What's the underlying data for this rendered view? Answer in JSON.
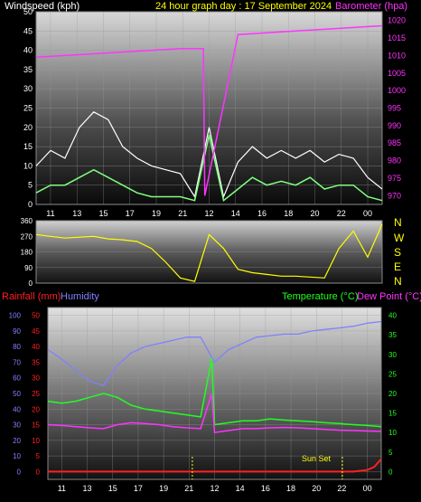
{
  "top": {
    "left_label": "Windspeed (kph)",
    "center_label": "24 hour graph day : 17 September 2024",
    "right_label": "Barometer (hpa)"
  },
  "mid": {
    "compass": [
      "N",
      "W",
      "S",
      "E",
      "N"
    ]
  },
  "bottom": {
    "rain_label": "Rainfall (mm)",
    "humidity_label": "Humidity",
    "temp_label": "Temperature (°C)",
    "dew_label": "Dew Point (°C)",
    "annotation": "Sun Set"
  },
  "colors": {
    "wind": "#ffffff",
    "gust": "#ffffff",
    "avg_wind": "#7fff7f",
    "barometer": "#ff33ff",
    "direction": "#ffff00",
    "rainfall": "#ff2020",
    "humidity": "#8080ff",
    "temperature": "#20ff20",
    "dewpoint": "#ff33ff"
  },
  "chart_data": [
    {
      "type": "line",
      "panel": "wind-barometer",
      "x_ticks": [
        "11",
        "13",
        "15",
        "17",
        "19",
        "21",
        "12",
        "14",
        "16",
        "18",
        "20",
        "22",
        "00"
      ],
      "y_left_ticks": [
        "0",
        "5",
        "10",
        "15",
        "20",
        "25",
        "30",
        "35",
        "40",
        "45",
        "50"
      ],
      "y_left_range": [
        0,
        50
      ],
      "y_right_ticks": [
        "970",
        "975",
        "980",
        "985",
        "990",
        "995",
        "1000",
        "1005",
        "1010",
        "1015",
        "1020"
      ],
      "y_right_range": [
        967.5,
        1022.5
      ],
      "series": [
        {
          "role": "gust",
          "x": [
            0,
            1,
            2,
            3,
            4,
            5,
            6,
            7,
            8,
            9,
            10,
            11,
            12,
            13,
            14,
            15,
            16,
            17,
            18,
            19,
            20,
            21,
            22,
            23,
            24
          ],
          "y": [
            10,
            14,
            12,
            20,
            24,
            22,
            15,
            12,
            10,
            9,
            8,
            2,
            20,
            2,
            11,
            15,
            12,
            14,
            12,
            14,
            11,
            13,
            12,
            7,
            4
          ]
        },
        {
          "role": "avg",
          "x": [
            0,
            1,
            2,
            3,
            4,
            5,
            6,
            7,
            8,
            9,
            10,
            11,
            12,
            13,
            14,
            15,
            16,
            17,
            18,
            19,
            20,
            21,
            22,
            23,
            24
          ],
          "y": [
            3,
            5,
            5,
            7,
            9,
            7,
            5,
            3,
            2,
            2,
            2,
            1,
            18,
            1,
            4,
            7,
            5,
            6,
            5,
            7,
            4,
            5,
            5,
            2,
            1
          ]
        },
        {
          "role": "barometer",
          "x": [
            0,
            2,
            4,
            6,
            8,
            10,
            11.6,
            11.7,
            14,
            16,
            18,
            20,
            22,
            24
          ],
          "y": [
            1009.5,
            1010,
            1010.5,
            1011,
            1011.5,
            1012,
            1012,
            970,
            1016,
            1016.5,
            1017,
            1017.5,
            1018,
            1018.5
          ]
        }
      ]
    },
    {
      "type": "line",
      "panel": "wind-direction",
      "y_ticks": [
        "0",
        "90",
        "180",
        "270",
        "360"
      ],
      "y_range": [
        0,
        360
      ],
      "series": [
        {
          "role": "direction",
          "x": [
            0,
            1,
            2,
            3,
            4,
            5,
            6,
            7,
            8,
            9,
            10,
            11,
            12,
            13,
            14,
            15,
            16,
            17,
            18,
            19,
            20,
            21,
            22,
            23,
            24
          ],
          "y": [
            280,
            270,
            260,
            265,
            270,
            255,
            250,
            240,
            200,
            120,
            30,
            10,
            280,
            200,
            80,
            60,
            50,
            40,
            40,
            35,
            30,
            200,
            300,
            150,
            340
          ]
        }
      ]
    },
    {
      "type": "line",
      "panel": "temperature-humidity",
      "x_ticks": [
        "11",
        "13",
        "15",
        "17",
        "19",
        "21",
        "12",
        "14",
        "16",
        "18",
        "20",
        "22",
        "00"
      ],
      "y_left_ticks": [
        "0",
        "5",
        "10",
        "15",
        "20",
        "25",
        "30",
        "35",
        "40",
        "45",
        "50"
      ],
      "y_left_range": [
        -2.5,
        52.5
      ],
      "y_rain_ticks": [
        "0",
        "10",
        "20",
        "30",
        "40",
        "50",
        "60",
        "70",
        "80",
        "90",
        "100"
      ],
      "y_rain_range": [
        -5,
        105
      ],
      "y_right_ticks": [
        "0",
        "5",
        "10",
        "15",
        "20",
        "25",
        "30",
        "35",
        "40"
      ],
      "y_right_range": [
        -2,
        42
      ],
      "series": [
        {
          "role": "humidity",
          "x": [
            0,
            1,
            2,
            3,
            4,
            5,
            6,
            7,
            8,
            9,
            10,
            11,
            12,
            13,
            14,
            15,
            16,
            17,
            18,
            19,
            20,
            21,
            22,
            23,
            24
          ],
          "y": [
            78,
            72,
            65,
            58,
            55,
            68,
            76,
            80,
            82,
            84,
            86,
            86,
            70,
            78,
            82,
            86,
            87,
            88,
            88,
            90,
            91,
            92,
            93,
            95,
            96
          ]
        },
        {
          "role": "temperature",
          "x": [
            0,
            1,
            2,
            3,
            4,
            5,
            6,
            7,
            8,
            9,
            10,
            11,
            11.8,
            12,
            13,
            14,
            15,
            16,
            17,
            18,
            19,
            20,
            21,
            22,
            23,
            24
          ],
          "y": [
            18,
            17.5,
            18,
            19,
            20,
            19,
            17,
            16,
            15.5,
            15,
            14.5,
            14,
            29,
            12,
            12.5,
            13,
            13,
            13.5,
            13.2,
            13,
            12.8,
            12.5,
            12.3,
            12,
            11.8,
            11.5
          ]
        },
        {
          "role": "dewpoint",
          "x": [
            0,
            1,
            2,
            3,
            4,
            5,
            6,
            7,
            8,
            9,
            10,
            11,
            11.8,
            12,
            13,
            14,
            15,
            16,
            17,
            18,
            19,
            20,
            21,
            22,
            23,
            24
          ],
          "y": [
            12,
            11.8,
            11.5,
            11.2,
            11,
            12,
            12.5,
            12.3,
            12,
            11.5,
            11.2,
            11,
            20,
            10,
            10.5,
            11,
            11,
            11.2,
            11.3,
            11.2,
            11,
            10.8,
            10.6,
            10.5,
            10.4,
            10.3
          ]
        },
        {
          "role": "rainfall",
          "x": [
            0,
            4,
            8,
            12,
            16,
            20,
            22,
            23,
            23.5,
            24
          ],
          "y": [
            0,
            0,
            0,
            0,
            0,
            0,
            0,
            0.5,
            1.5,
            4
          ]
        }
      ]
    }
  ]
}
